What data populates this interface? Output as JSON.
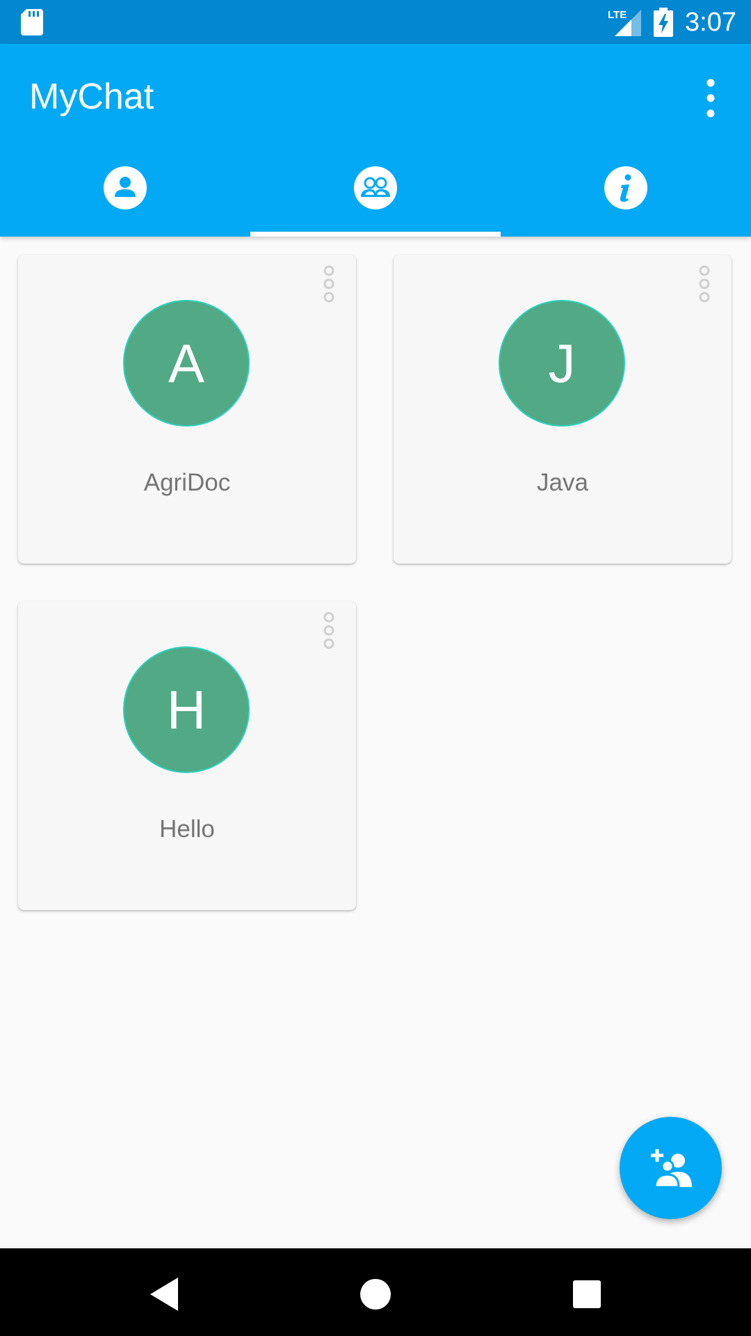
{
  "status_bar": {
    "time": "3:07",
    "network": "LTE",
    "icons": [
      "sd-card-icon",
      "lte-signal-icon",
      "battery-charging-icon"
    ]
  },
  "app_bar": {
    "title": "MyChat",
    "overflow_icon": "more-vertical-icon"
  },
  "tabs": [
    {
      "icon": "person-icon",
      "selected": false
    },
    {
      "icon": "group-icon",
      "selected": true
    },
    {
      "icon": "info-icon",
      "selected": false
    }
  ],
  "groups": [
    {
      "initial": "A",
      "name": "AgriDoc"
    },
    {
      "initial": "J",
      "name": "Java"
    },
    {
      "initial": "H",
      "name": "Hello"
    }
  ],
  "fab": {
    "icon": "add-group-icon"
  },
  "nav_bar": {
    "icons": [
      "back-icon",
      "home-icon",
      "recents-icon"
    ]
  },
  "colors": {
    "status_bar": "#0288d1",
    "app_bar": "#03a9f4",
    "avatar": "#52a985",
    "avatar_border": "#2bd1b8",
    "background": "#fafafa",
    "card": "#f7f7f7"
  }
}
